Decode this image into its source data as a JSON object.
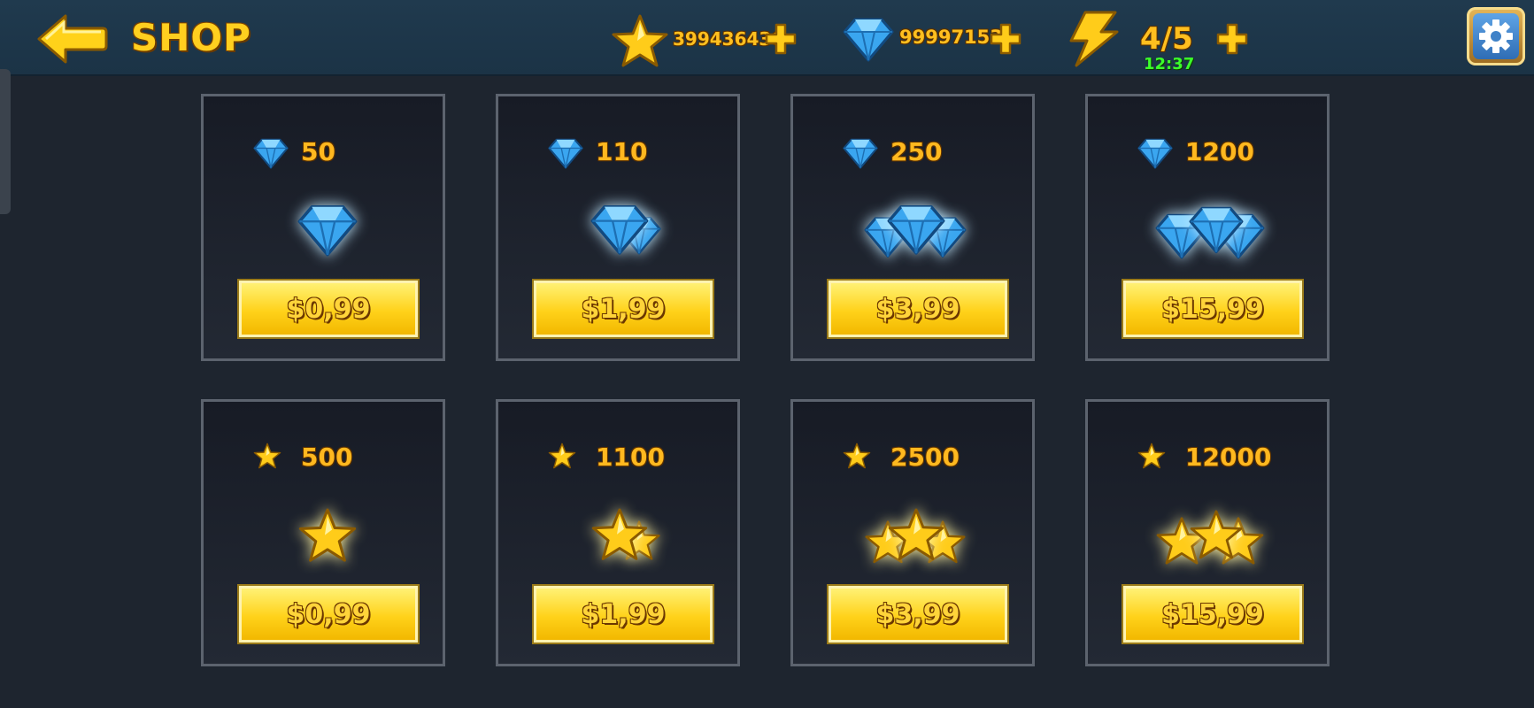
{
  "header": {
    "title": "SHOP",
    "stars": "39943643O",
    "gems": "99997153",
    "energy": "4/5",
    "energy_timer": "12:37"
  },
  "colors": {
    "gold": "#ffcf1f",
    "gem_blue": "#3aa6f0",
    "timer_green": "#3cff2a",
    "card_border": "#5c636e",
    "button_yellow": "#ffd21a"
  },
  "offers": [
    {
      "currency": "gem",
      "amount": "50",
      "price": "$0,99",
      "art": "single-gem-icon"
    },
    {
      "currency": "gem",
      "amount": "110",
      "price": "$1,99",
      "art": "gem-pair-icon"
    },
    {
      "currency": "gem",
      "amount": "250",
      "price": "$3,99",
      "art": "gem-pile-icon"
    },
    {
      "currency": "gem",
      "amount": "1200",
      "price": "$15,99",
      "art": "gem-heap-icon"
    },
    {
      "currency": "star",
      "amount": "500",
      "price": "$0,99",
      "art": "single-star-icon"
    },
    {
      "currency": "star",
      "amount": "1100",
      "price": "$1,99",
      "art": "star-pair-icon"
    },
    {
      "currency": "star",
      "amount": "2500",
      "price": "$3,99",
      "art": "star-pile-icon"
    },
    {
      "currency": "star",
      "amount": "12000",
      "price": "$15,99",
      "art": "star-heap-icon"
    }
  ]
}
